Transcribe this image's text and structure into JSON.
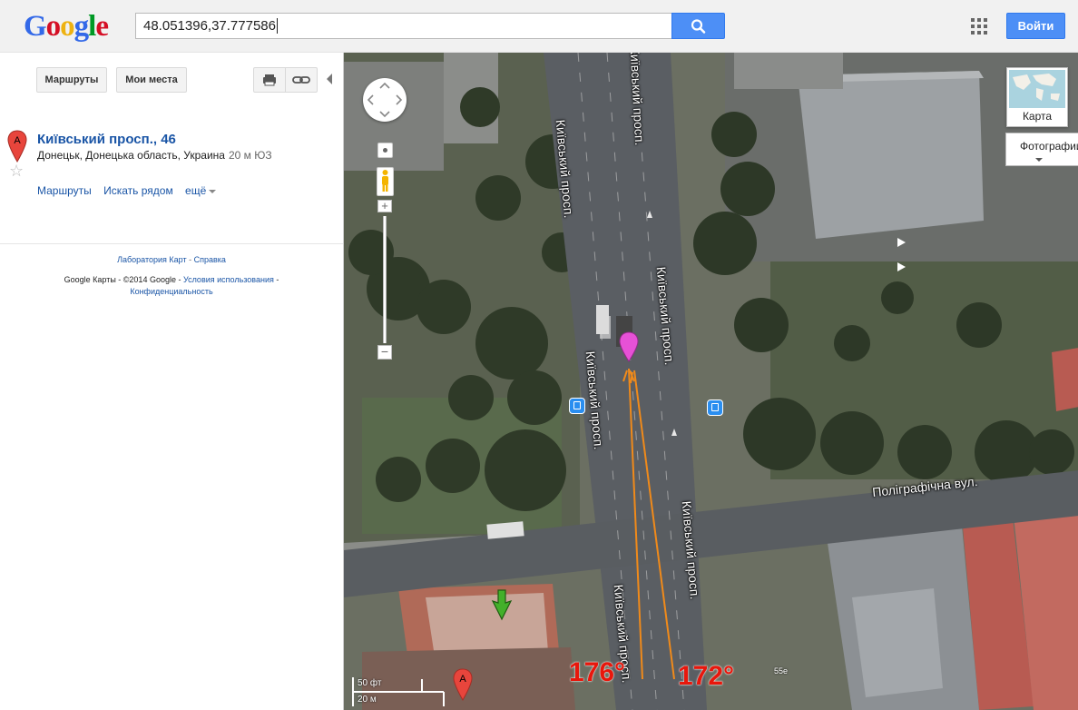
{
  "header": {
    "logo_letters": [
      {
        "char": "G",
        "color": "#3369e8"
      },
      {
        "char": "o",
        "color": "#d50f25"
      },
      {
        "char": "o",
        "color": "#eeb211"
      },
      {
        "char": "g",
        "color": "#3369e8"
      },
      {
        "char": "l",
        "color": "#009925"
      },
      {
        "char": "e",
        "color": "#d50f25"
      }
    ],
    "search_value": "48.051396,37.777586",
    "search_icon": "search-icon",
    "apps_icon": "apps-grid-icon",
    "signin_label": "Войти"
  },
  "sidebar": {
    "routes_label": "Маршруты",
    "myplaces_label": "Мои места",
    "print_icon": "print-icon",
    "link_icon": "link-icon",
    "result": {
      "marker_letter": "A",
      "title": "Київський просп., 46",
      "address": "Донецьк, Донецька область, Украина",
      "distance": "20 м ЮЗ",
      "links": {
        "routes": "Маршруты",
        "nearby": "Искать рядом",
        "more": "ещё"
      }
    },
    "footer": {
      "labs": "Лаборатория Карт",
      "sep": " - ",
      "help": "Справка",
      "copyright": "Google Карты - ©2014 Google - ",
      "terms": "Условия использования",
      "sep2": " -",
      "privacy": "Конфиденциальность"
    }
  },
  "map": {
    "map_type_label": "Карта",
    "photos_label": "Фотографии",
    "scale_ft": "50 фт",
    "scale_m": "20 м",
    "street_labels": {
      "s1": "Київський просп.",
      "s2": "Київський просп.",
      "s3": "Київський просп.",
      "s4": "Київський просп.",
      "s5": "Київський просп.",
      "s6": "Київський просп.",
      "s7": "Поліграфічна вул."
    },
    "angle_left": "176°",
    "angle_right": "172°",
    "poi_label": "55е",
    "colors": {
      "road": "#5d6165",
      "grass": "#56604a",
      "tree": "#2f3a28",
      "roof_red": "#b8574f",
      "roof_grey": "#8e9296",
      "orange_line": "#f08a1a",
      "pink_marker": "#e651d6",
      "green_arrow": "#43b02a"
    }
  }
}
